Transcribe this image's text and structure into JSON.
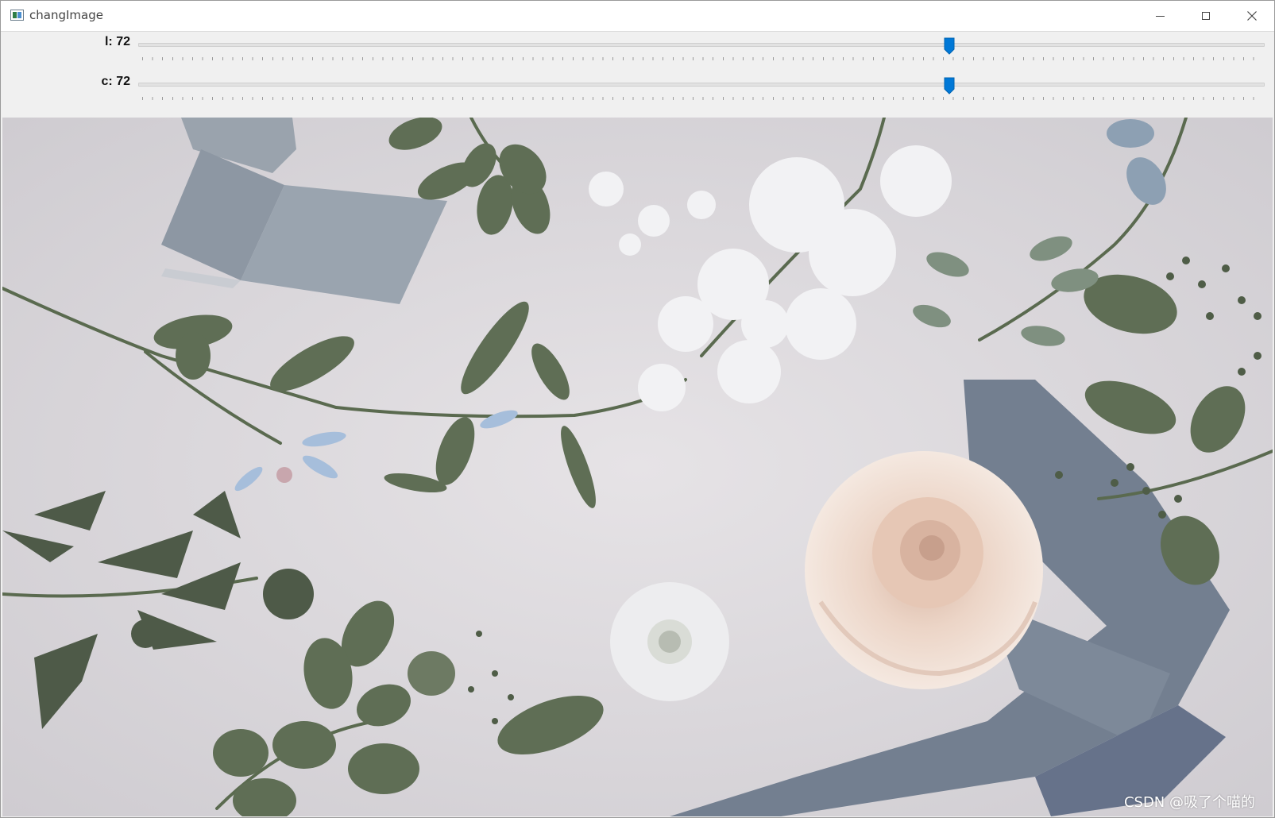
{
  "window": {
    "title": "changImage",
    "app_icon": "opencv-window-icon",
    "controls": [
      "minimize-icon",
      "maximize-icon",
      "close-icon"
    ]
  },
  "trackbars": [
    {
      "name": "l",
      "label": "l: 72",
      "value": 72,
      "max": 100,
      "accent": "#0078d7"
    },
    {
      "name": "c",
      "label": "c: 72",
      "value": 72,
      "max": 100,
      "accent": "#0078d7"
    }
  ],
  "image": {
    "watermark": "CSDN @吸了个喵的"
  },
  "colors": {
    "thumb": "#0078d7",
    "background": "#dcd9dc",
    "ribbon": "#8a96a6",
    "leaf": "#5f6e55",
    "rose": "#f1ddd0"
  }
}
